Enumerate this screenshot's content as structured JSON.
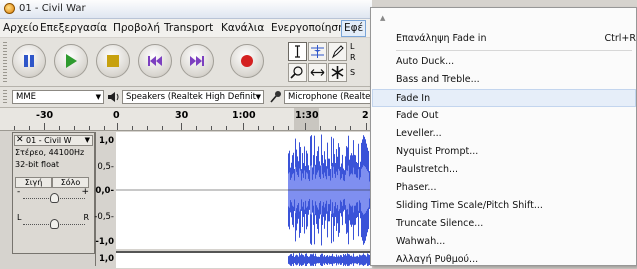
{
  "window": {
    "title": "01 - Civil War"
  },
  "menubar": {
    "items": [
      "Αρχείο",
      "Επεξεργασία",
      "Προβολή",
      "Transport",
      "Κανάλια",
      "Ενεργοποίηση",
      "Εφέ"
    ]
  },
  "devices": {
    "host": "MME",
    "output": "Speakers (Realtek High Definit",
    "input": "Microphone (Realtek"
  },
  "ruler": {
    "labels": [
      "-30",
      "0",
      "30",
      "1:00",
      "1:30",
      "2"
    ]
  },
  "tools": {
    "label_l": "L",
    "label_r": "R",
    "label_s": "S"
  },
  "track": {
    "name": "01 - Civil W",
    "info1": "Στέρεο, 44100Hz",
    "info2": "32-bit float",
    "mute": "Σιγή",
    "solo": "Σόλο",
    "gain_minus": "-",
    "gain_plus": "+",
    "pan_left": "L",
    "pan_right": "R"
  },
  "scale": {
    "labels": [
      "1,0",
      "0,5-",
      "0,0-",
      "-0,5-",
      "-1,0",
      "1,0"
    ]
  },
  "effects_menu": {
    "repeat_item": {
      "label": "Επανάληψη Fade in",
      "shortcut": "Ctrl+R"
    },
    "items": [
      "Auto Duck...",
      "Bass and Treble...",
      "Fade In",
      "Fade Out",
      "Leveller...",
      "Nyquist Prompt...",
      "Paulstretch...",
      "Phaser...",
      "Sliding Time Scale/Pitch Shift...",
      "Truncate Silence...",
      "Wahwah...",
      "Αλλαγή Ρυθμού..."
    ],
    "highlighted": "Fade In"
  },
  "colors": {
    "waveform": "#3a53d8",
    "waveform_light": "#7f8ff0",
    "menu_highlight": "#e6eef9"
  }
}
